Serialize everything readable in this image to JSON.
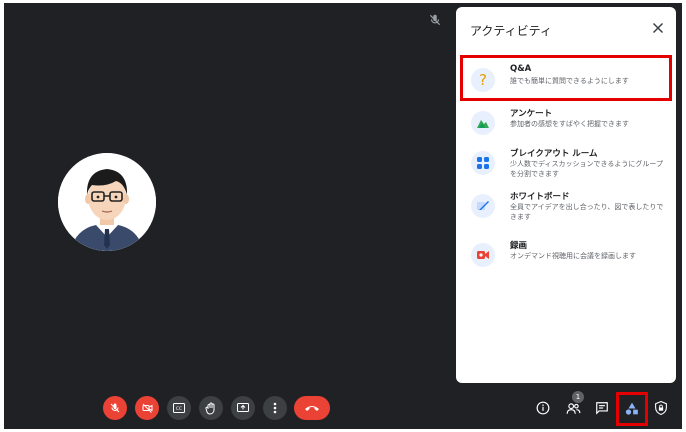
{
  "panel": {
    "title": "アクティビティ",
    "items": [
      {
        "name": "Q&A",
        "description": "誰でも簡単に質問できるようにします",
        "icon": "question-icon"
      },
      {
        "name": "アンケート",
        "description": "参加者の感想をすばやく把握できます",
        "icon": "poll-icon"
      },
      {
        "name": "ブレイクアウト ルーム",
        "description": "少人数でディスカッションできるようにグループを分割できます",
        "icon": "breakout-rooms-icon"
      },
      {
        "name": "ホワイトボード",
        "description": "全員でアイデアを出し合ったり、図で表したりできます",
        "icon": "whiteboard-icon"
      },
      {
        "name": "録画",
        "description": "オンデマンド視聴用に会議を録画します",
        "icon": "record-icon"
      }
    ]
  },
  "toolbar": {
    "people_badge": "1"
  },
  "colors": {
    "background": "#202124",
    "end_call": "#ea4335",
    "highlight": "#e50000",
    "icon_bg": "#e8f0fe"
  }
}
